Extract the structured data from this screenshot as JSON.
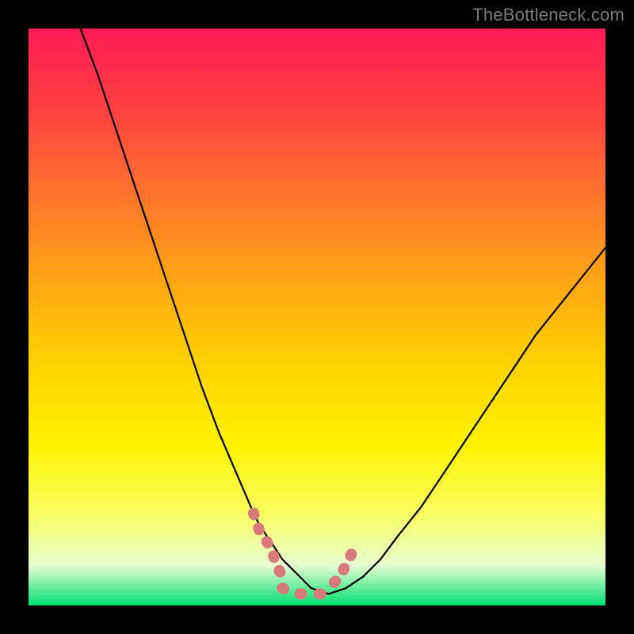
{
  "watermark": {
    "text": "TheBottleneck.com"
  },
  "colors": {
    "frame_black": "#000000",
    "gradient_top": "#ff1a55",
    "gradient_mid_orange": "#ff9a1a",
    "gradient_yellow": "#fff200",
    "gradient_green": "#00e070",
    "curve_black": "#000000",
    "highlight_pink": "#d97a7a"
  },
  "chart_data": {
    "type": "line",
    "title": "",
    "xlabel": "",
    "ylabel": "",
    "xlim": [
      0,
      100
    ],
    "ylim": [
      0,
      100
    ],
    "series": [
      {
        "name": "left-curve",
        "x": [
          9,
          12,
          15,
          18,
          21,
          24,
          27,
          30,
          33,
          36,
          39,
          40,
          42,
          44,
          46,
          49,
          52
        ],
        "values": [
          100,
          92,
          83,
          74,
          65,
          56,
          47,
          38,
          30,
          23,
          16,
          14,
          11,
          8,
          6,
          3,
          2
        ]
      },
      {
        "name": "right-curve",
        "x": [
          52,
          55,
          58,
          61,
          64,
          68,
          72,
          76,
          80,
          84,
          88,
          92,
          96,
          100
        ],
        "values": [
          2,
          3,
          5,
          8,
          12,
          17,
          23,
          29,
          35,
          41,
          47,
          52,
          57,
          62
        ]
      },
      {
        "name": "left-highlight",
        "x": [
          39,
          40,
          42,
          43,
          44
        ],
        "values": [
          16,
          13,
          10,
          7,
          5
        ]
      },
      {
        "name": "right-highlight",
        "x": [
          53,
          54,
          55,
          56,
          57
        ],
        "values": [
          4,
          5,
          7,
          9,
          11
        ]
      },
      {
        "name": "bottom-highlight",
        "x": [
          44,
          46,
          48,
          50,
          52,
          53
        ],
        "values": [
          3,
          2,
          2,
          2,
          2,
          3
        ]
      }
    ],
    "grid": false,
    "legend": false
  }
}
